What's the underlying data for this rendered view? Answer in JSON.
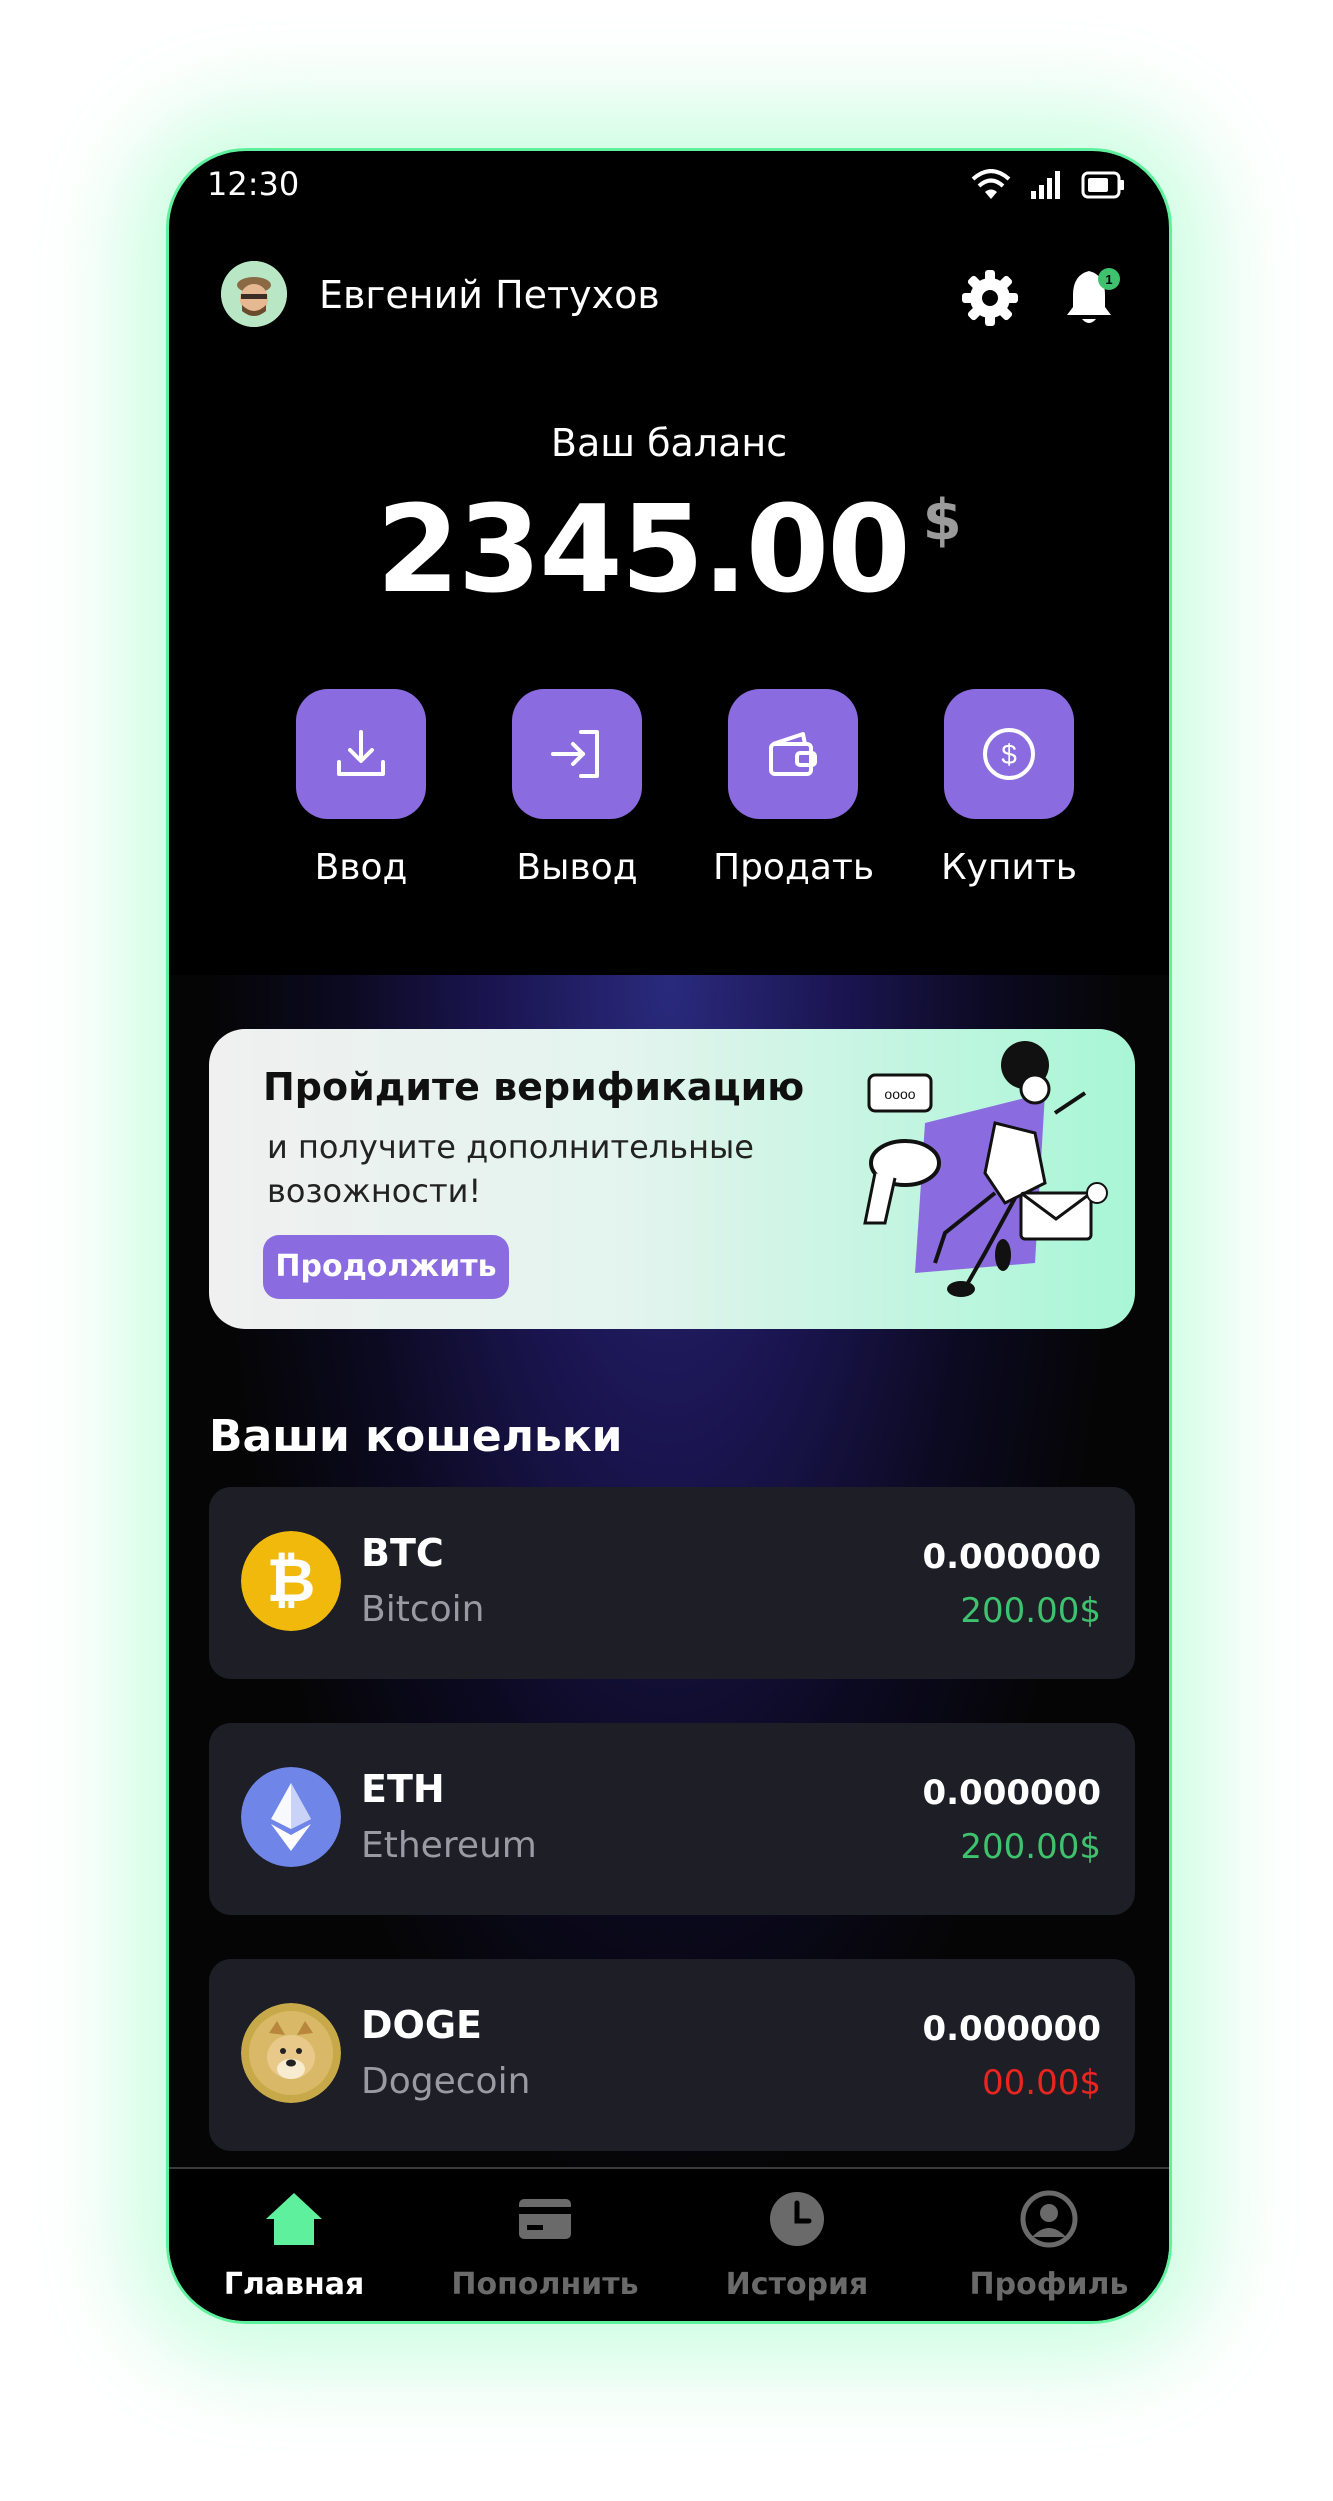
{
  "status": {
    "time": "12:30"
  },
  "header": {
    "username": "Евгений Петухов",
    "notification_count": "1"
  },
  "balance": {
    "label": "Ваш баланс",
    "amount": "2345.00",
    "currency": "$"
  },
  "actions": [
    {
      "label": "Ввод",
      "icon": "download-icon"
    },
    {
      "label": "Вывод",
      "icon": "login-arrow-icon"
    },
    {
      "label": "Продать",
      "icon": "wallet-icon"
    },
    {
      "label": "Купить",
      "icon": "dollar-coin-icon"
    }
  ],
  "banner": {
    "title": "Пройдите верификацию",
    "text": "и получите дополнительные возожности!",
    "button": "Продолжить"
  },
  "wallets": {
    "title": "Ваши кошельки",
    "items": [
      {
        "ticker": "BTC",
        "name": "Bitcoin",
        "amount": "0.000000",
        "usd": "200.00$",
        "usd_color": "#3ec26e",
        "icon": "bitcoin-icon"
      },
      {
        "ticker": "ETH",
        "name": "Ethereum",
        "amount": "0.000000",
        "usd": "200.00$",
        "usd_color": "#3ec26e",
        "icon": "ethereum-icon"
      },
      {
        "ticker": "DOGE",
        "name": "Dogecoin",
        "amount": "0.000000",
        "usd": "00.00$",
        "usd_color": "#e8251e",
        "icon": "dogecoin-icon"
      }
    ]
  },
  "tabs": [
    {
      "label": "Главная",
      "icon": "home-icon",
      "active": true
    },
    {
      "label": "Пополнить",
      "icon": "card-icon",
      "active": false
    },
    {
      "label": "История",
      "icon": "clock-icon",
      "active": false
    },
    {
      "label": "Профиль",
      "icon": "profile-icon",
      "active": false
    }
  ],
  "colors": {
    "accent": "#8b6ce0",
    "active_tab": "#5ff09d",
    "glow": "#5ff09d"
  }
}
